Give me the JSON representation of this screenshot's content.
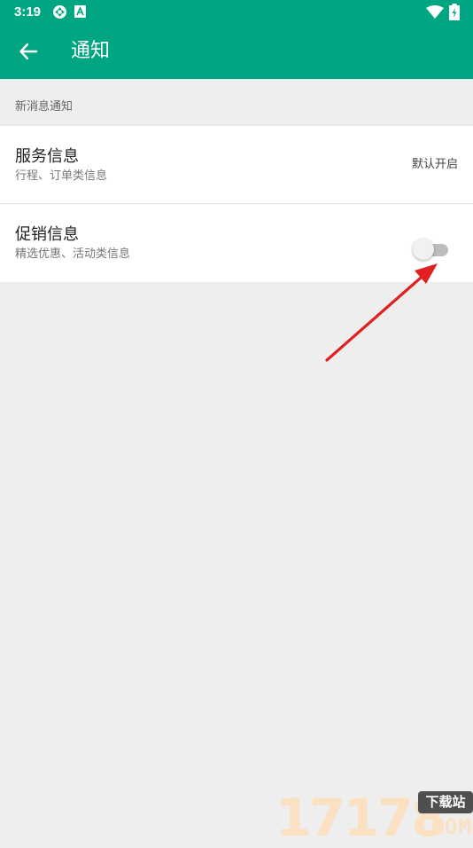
{
  "status_bar": {
    "time": "3:19",
    "icons": [
      "sync-icon",
      "a-badge-icon",
      "wifi-icon",
      "battery-icon"
    ]
  },
  "app_bar": {
    "title": "通知",
    "back_icon": "arrow-left-icon",
    "background_color": "#00a682"
  },
  "section": {
    "title": "新消息通知"
  },
  "settings": [
    {
      "title": "服务信息",
      "subtitle": "行程、订单类信息",
      "value": "默认开启"
    },
    {
      "title": "促销信息",
      "subtitle": "精选优惠、活动类信息",
      "toggle_on": false
    }
  ],
  "annotation": {
    "arrow_color": "#e02020"
  },
  "watermark": {
    "digits": "17178",
    "badge": "下载站",
    "suffix": ".COM"
  }
}
